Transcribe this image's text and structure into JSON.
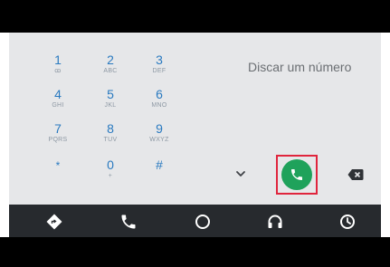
{
  "dialer": {
    "title": "Discar um número",
    "keys": [
      {
        "digit": "1",
        "letters": "ꝏ"
      },
      {
        "digit": "2",
        "letters": "ABC"
      },
      {
        "digit": "3",
        "letters": "DEF"
      },
      {
        "digit": "4",
        "letters": "GHI"
      },
      {
        "digit": "5",
        "letters": "JKL"
      },
      {
        "digit": "6",
        "letters": "MNO"
      },
      {
        "digit": "7",
        "letters": "PQRS"
      },
      {
        "digit": "8",
        "letters": "TUV"
      },
      {
        "digit": "9",
        "letters": "WXYZ"
      },
      {
        "digit": "*",
        "letters": ""
      },
      {
        "digit": "0",
        "letters": "+"
      },
      {
        "digit": "#",
        "letters": ""
      }
    ]
  },
  "nav": {
    "items": [
      "navigation-icon",
      "phone-icon",
      "home-circle-icon",
      "headphones-icon",
      "recents-clock-icon"
    ]
  },
  "colors": {
    "accent": "#2a7ac0",
    "call_green": "#1fa25b",
    "highlight_red": "#e0253d",
    "nav_bar": "#272a2e",
    "display_bg": "#e6e7e9"
  }
}
